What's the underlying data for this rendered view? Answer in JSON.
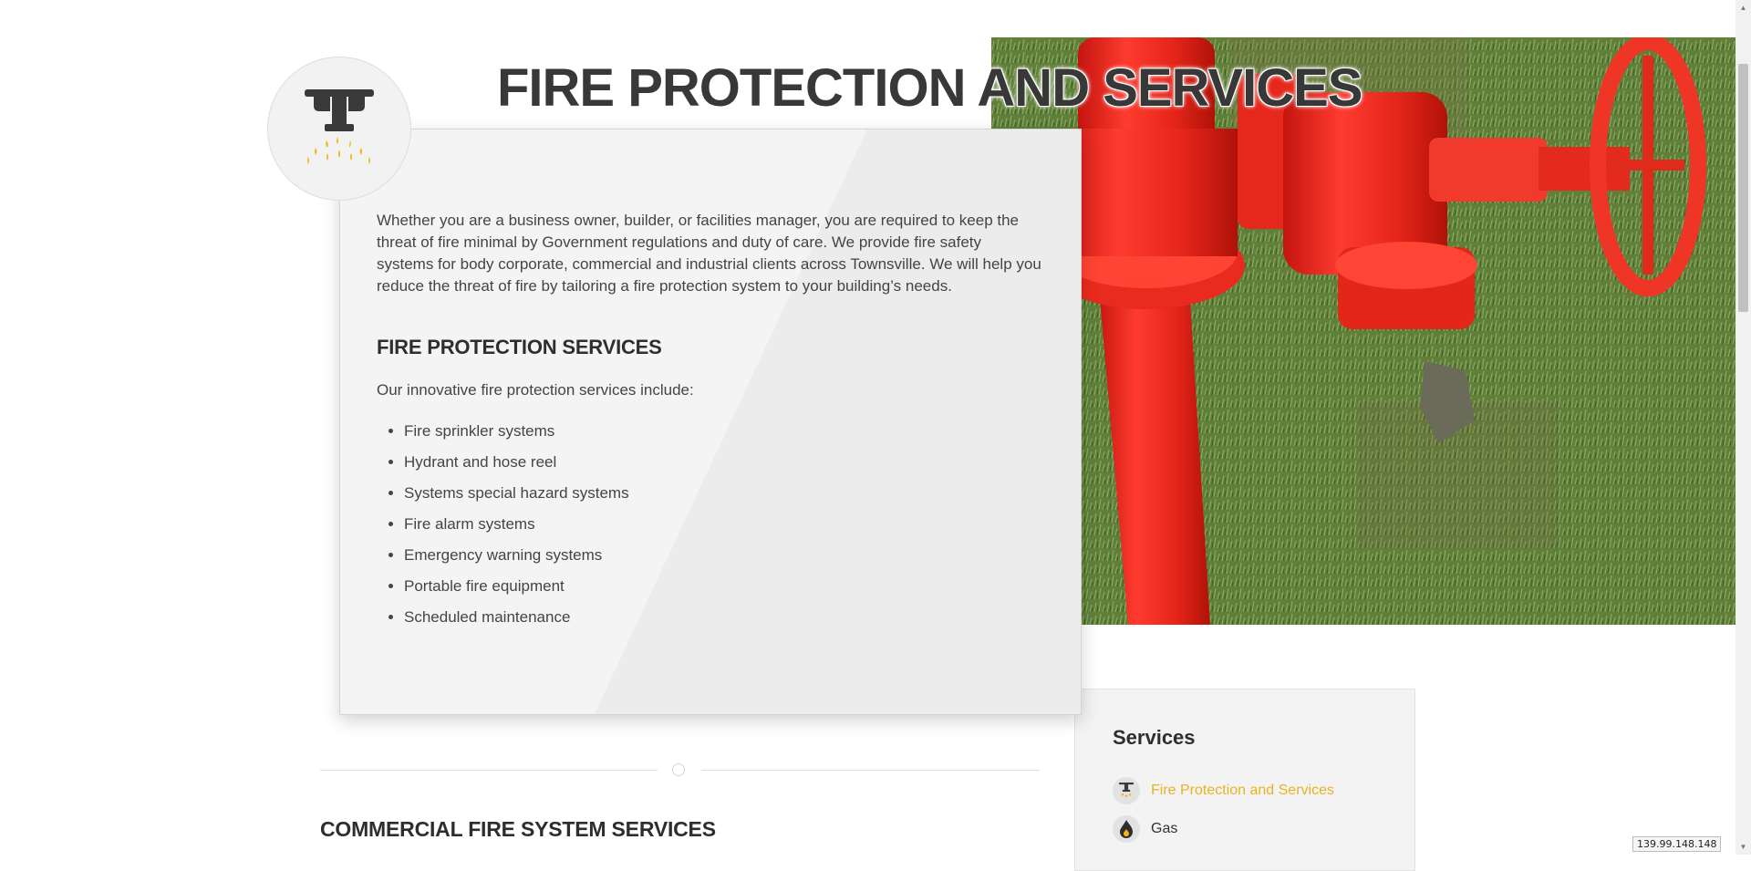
{
  "page": {
    "title": "FIRE PROTECTION AND SERVICES",
    "accent_color": "#e9b320",
    "emblem_icon": "fire-sprinkler-icon"
  },
  "hero": {
    "image_subject": "red-fire-hydrant-on-grass"
  },
  "main": {
    "intro": "Whether you are a business owner, builder, or facilities manager, you are required to keep the threat of fire minimal by Government regulations and duty of care. We provide fire safety systems for body corporate, commercial and industrial clients across Townsville. We will help you reduce the threat of fire by tailoring a fire protection system to your building’s needs.",
    "services_heading": "FIRE PROTECTION SERVICES",
    "services_lead": "Our innovative fire protection services include:",
    "services": [
      "Fire sprinkler systems",
      "Hydrant and hose reel",
      "Systems special hazard systems",
      "Fire alarm systems",
      "Emergency warning systems",
      "Portable fire equipment",
      "Scheduled maintenance"
    ],
    "commercial_heading": "COMMERCIAL FIRE SYSTEM SERVICES"
  },
  "sidebar": {
    "title": "Services",
    "items": [
      {
        "label": "Fire Protection and Services",
        "icon": "fire-sprinkler-icon",
        "active": true
      },
      {
        "label": "Gas",
        "icon": "gas-flame-icon",
        "active": false
      }
    ]
  },
  "status": {
    "ip_address": "139.99.148.148"
  }
}
